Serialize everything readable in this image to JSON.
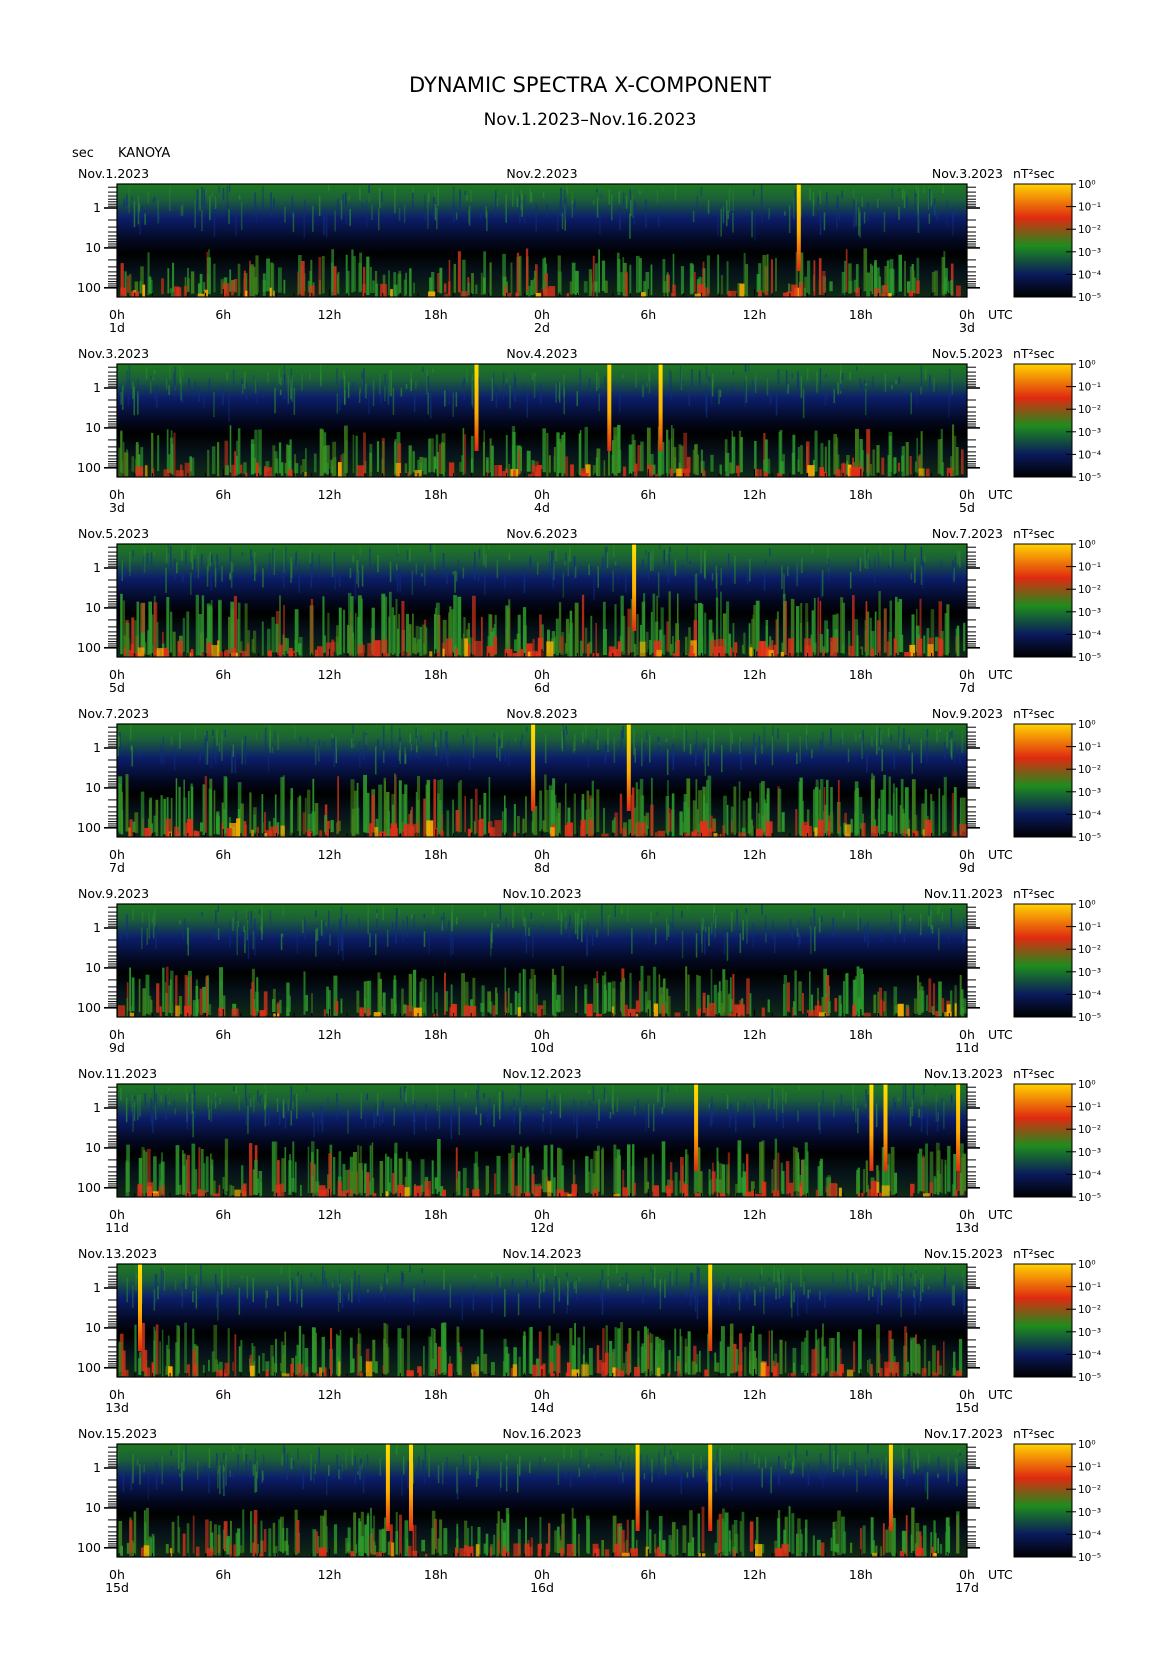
{
  "header": {
    "title": "DYNAMIC SPECTRA X-COMPONENT",
    "subtitle": "Nov.1.2023–Nov.16.2023",
    "ylabel": "sec",
    "station": "KANOYA"
  },
  "colorbar": {
    "unit": "nT²sec",
    "labels": [
      "10⁰",
      "10⁻¹",
      "10⁻²",
      "10⁻³",
      "10⁻⁴",
      "10⁻⁵"
    ],
    "colors": [
      "#000000",
      "#0a1a5c",
      "#1e8c1e",
      "#e02a10",
      "#ffd400"
    ]
  },
  "chart_data": {
    "type": "heatmap",
    "y_axis": {
      "label": "sec",
      "scale": "log",
      "ticks": [
        "1",
        "10",
        "100"
      ]
    },
    "x_tick_labels": [
      "0h",
      "6h",
      "12h",
      "18h",
      "0h",
      "6h",
      "12h",
      "18h",
      "0h"
    ],
    "utc_label": "UTC",
    "panels": [
      {
        "date_left": "Nov.1.2023",
        "date_mid": "Nov.2.2023",
        "date_right": "Nov.3.2023",
        "day_left": "1d",
        "day_mid": "2d",
        "day_right": "3d",
        "spikes_hours": [
          38.5
        ],
        "activity": 0.35
      },
      {
        "date_left": "Nov.3.2023",
        "date_mid": "Nov.4.2023",
        "date_right": "Nov.5.2023",
        "day_left": "3d",
        "day_mid": "4d",
        "day_right": "5d",
        "spikes_hours": [
          20.3,
          27.8,
          30.7
        ],
        "activity": 0.45
      },
      {
        "date_left": "Nov.5.2023",
        "date_mid": "Nov.6.2023",
        "date_right": "Nov.7.2023",
        "day_left": "5d",
        "day_mid": "6d",
        "day_right": "7d",
        "spikes_hours": [
          29.2
        ],
        "activity": 0.75
      },
      {
        "date_left": "Nov.7.2023",
        "date_mid": "Nov.8.2023",
        "date_right": "Nov.9.2023",
        "day_left": "7d",
        "day_mid": "8d",
        "day_right": "9d",
        "spikes_hours": [
          23.5,
          28.9
        ],
        "activity": 0.7
      },
      {
        "date_left": "Nov.9.2023",
        "date_mid": "Nov.10.2023",
        "date_right": "Nov.11.2023",
        "day_left": "9d",
        "day_mid": "10d",
        "day_right": "11d",
        "spikes_hours": [],
        "activity": 0.4
      },
      {
        "date_left": "Nov.11.2023",
        "date_mid": "Nov.12.2023",
        "date_right": "Nov.13.2023",
        "day_left": "11d",
        "day_mid": "12d",
        "day_right": "13d",
        "spikes_hours": [
          32.7,
          42.6,
          43.4,
          47.5
        ],
        "activity": 0.55
      },
      {
        "date_left": "Nov.13.2023",
        "date_mid": "Nov.14.2023",
        "date_right": "Nov.15.2023",
        "day_left": "13d",
        "day_mid": "14d",
        "day_right": "15d",
        "spikes_hours": [
          1.3,
          33.5
        ],
        "activity": 0.5
      },
      {
        "date_left": "Nov.15.2023",
        "date_mid": "Nov.16.2023",
        "date_right": "Nov.17.2023",
        "day_left": "15d",
        "day_mid": "16d",
        "day_right": "17d",
        "spikes_hours": [
          15.3,
          16.6,
          29.4,
          33.5,
          43.7
        ],
        "activity": 0.4
      }
    ]
  }
}
